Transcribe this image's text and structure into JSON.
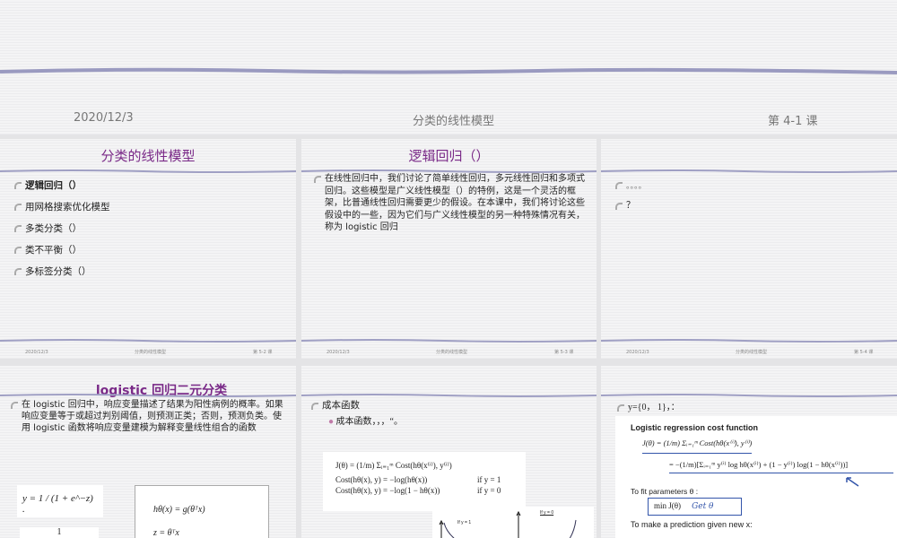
{
  "top_footer": {
    "date": "2020/12/3",
    "title": "分类的线性模型",
    "lesson": "第 4-1 课"
  },
  "slides": [
    {
      "title": "分类的线性模型",
      "items": [
        "逻辑回归（）",
        "用网格搜索优化模型",
        "多类分类（）",
        "类不平衡（）",
        "多标签分类（）"
      ],
      "footer": {
        "date": "2020/12/3",
        "title": "分类的线性模型",
        "page": "第 5-2 课"
      }
    },
    {
      "title": "逻辑回归（）",
      "body": "在线性回归中，我们讨论了简单线性回归，多元线性回归和多项式回归。这些模型是广义线性模型（）的特例，这是一个灵活的框架，比普通线性回归需要更少的假设。在本课中，我们将讨论这些假设中的一些，因为它们与广义线性模型的另一种特殊情况有关，称为 logistic 回归",
      "footer": {
        "date": "2020/12/3",
        "title": "分类的线性模型",
        "page": "第 5-3 课"
      }
    },
    {
      "items": [
        "。。。。",
        "？"
      ],
      "footer": {
        "date": "2020/12/3",
        "title": "分类的线性模型",
        "page": "第 5-4 课"
      }
    },
    {
      "title": "logistic 回归二元分类",
      "body": "在 logistic 回归中，响应变量描述了结果为阳性病例的概率。如果响应变量等于或超过判别阈值，则预测正类；否则，预测负类。使用 logistic 函数将响应变量建模为解释变量线性组合的函数",
      "formulas": [
        "y = 1 / (1 + e^−z) .",
        "hθ(x) = g(θᵀx)",
        "z = θᵀx",
        "1"
      ]
    },
    {
      "item": "成本函数",
      "sub": "成本函数，，，“。",
      "formulas": [
        "J(θ) = (1/m) Σᵢ₌₁ᵐ Cost(hθ(x⁽ⁱ⁾), y⁽ⁱ⁾)",
        "Cost(hθ(x), y) = −log(hθ(x))",
        "if y = 1",
        "Cost(hθ(x), y) = −log(1 − hθ(x))",
        "if y = 0"
      ],
      "graph_labels": [
        "If y = 1",
        "If y = 0"
      ]
    },
    {
      "item": "y={0， 1}，：",
      "heading": "Logistic regression cost function",
      "formulas": [
        "J(θ) = (1/m) Σᵢ₌₁ᵐ Cost(hθ(x⁽ⁱ⁾), y⁽ⁱ⁾)",
        "= −(1/m)[Σᵢ₌₁ᵐ y⁽ⁱ⁾ log hθ(x⁽ⁱ⁾) + (1 − y⁽ⁱ⁾) log(1 − hθ(x⁽ⁱ⁾))]"
      ],
      "fit": "To fit parameters θ :",
      "min": "min J(θ)",
      "annotation": "Get θ",
      "predict": "To make a prediction given new x:"
    }
  ]
}
